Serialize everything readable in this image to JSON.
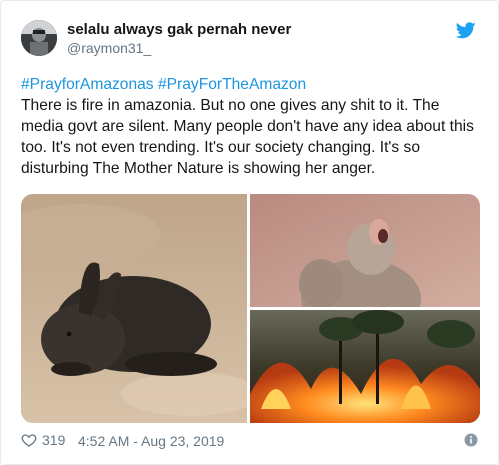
{
  "user": {
    "display_name": "selalu always gak pernah never",
    "handle": "@raymon31_"
  },
  "tweet": {
    "hashtags": [
      {
        "text": "#PrayforAmazonas"
      },
      {
        "text": "#PrayForTheAmazon"
      }
    ],
    "body": "There is fire in amazonia. But no one gives any shit to it. The media govt are silent. Many people don't have any idea about this too. It's not even trending. It's our society changing. It's so disturbing The Mother Nature is showing her anger."
  },
  "footer": {
    "like_count": "319",
    "timestamp": "4:52 AM - Aug 23, 2019"
  },
  "colors": {
    "link": "#1b95e0",
    "secondary_text": "#657786",
    "twitter_blue": "#1da1f2"
  },
  "icons": {
    "brand": "twitter-bird-icon",
    "like": "heart-outline-icon",
    "info": "info-circle-icon"
  }
}
